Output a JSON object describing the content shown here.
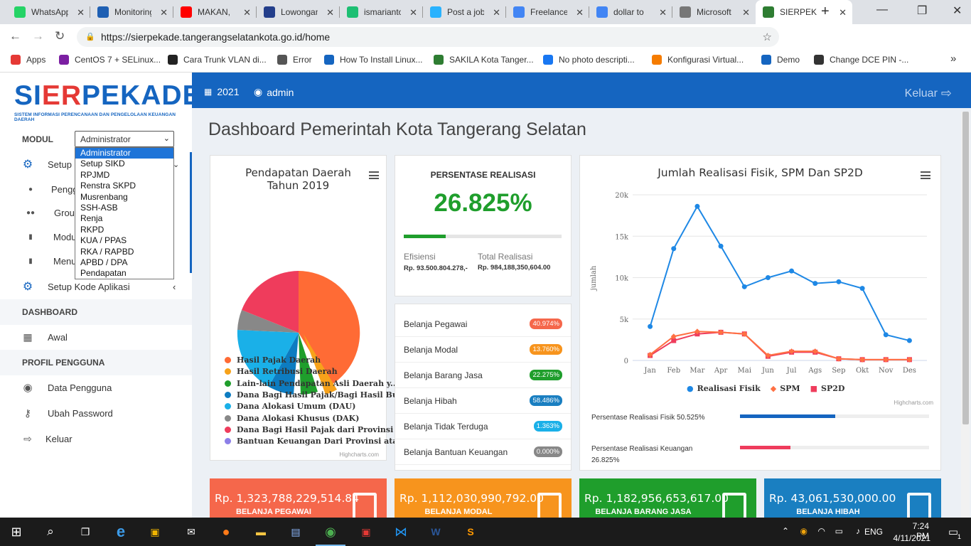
{
  "browser": {
    "tabs": [
      {
        "title": "WhatsApp",
        "icon": "whatsapp-icon",
        "color": "#25d366"
      },
      {
        "title": "Monitoring",
        "icon": "monitoring-icon",
        "color": "#1e5fb3"
      },
      {
        "title": "MAKAN,",
        "icon": "youtube-icon",
        "color": "#ff0000"
      },
      {
        "title": "Lowongan",
        "icon": "jobs-icon",
        "color": "#233e8b"
      },
      {
        "title": "ismarianto",
        "icon": "fiverr-icon",
        "color": "#1dbf73"
      },
      {
        "title": "Post a job",
        "icon": "freelancer-icon",
        "color": "#29b2fe"
      },
      {
        "title": "Freelance",
        "icon": "google-icon",
        "color": "#4285f4"
      },
      {
        "title": "dollar to",
        "icon": "google-icon",
        "color": "#4285f4"
      },
      {
        "title": "Microsoft",
        "icon": "globe-icon",
        "color": "#777777"
      },
      {
        "title": "SIERPEKA",
        "icon": "sierpekade-icon",
        "color": "#2e7d32"
      }
    ],
    "url": "https://sierpekade.tangerangselatankota.go.id/home",
    "bookmarks": [
      {
        "label": "Apps",
        "color": "#e53935"
      },
      {
        "label": "CentOS 7 + SELinux...",
        "color": "#7b1fa2"
      },
      {
        "label": "Cara Trunk VLAN di...",
        "color": "#222222"
      },
      {
        "label": "Error",
        "color": "#555555"
      },
      {
        "label": "How To Install Linux...",
        "color": "#1565c0"
      },
      {
        "label": "SAKILA Kota Tanger...",
        "color": "#2e7d32"
      },
      {
        "label": "No photo descripti...",
        "color": "#1877f2"
      },
      {
        "label": "Konfigurasi Virtual...",
        "color": "#f57c00"
      },
      {
        "label": "Demo",
        "color": "#1565c0"
      },
      {
        "label": "Change DCE PIN -...",
        "color": "#333333"
      }
    ],
    "more_bookmarks": "»"
  },
  "logo": {
    "part1": "SI",
    "part2": "ER",
    "part3": "PEKADE",
    "subtitle": "SISTEM INFORMASI PERENCANAAN DAN PENGELOLAAN KEUANGAN DAERAH"
  },
  "sidebar": {
    "modul_label": "MODUL",
    "modul_selected": "Administrator",
    "modul_options": [
      "Administrator",
      "Setup SIKD",
      "RPJMD",
      "Renstra SKPD",
      "Musrenbang",
      "SSH-ASB",
      "Renja",
      "RKPD",
      "KUA / PPAS",
      "RKA / RAPBD",
      "APBD / DPA",
      "Pendapatan"
    ],
    "setup_label": "Setup",
    "sub_items": [
      "Pengguna",
      "Group",
      "Modul",
      "Menu"
    ],
    "setup_kode": "Setup Kode Aplikasi",
    "dashboard_heading": "DASHBOARD",
    "awal": "Awal",
    "profil_heading": "PROFIL PENGGUNA",
    "data_pengguna": "Data Pengguna",
    "ubah_password": "Ubah Password",
    "keluar": "Keluar"
  },
  "topnav": {
    "year": "2021",
    "user": "admin",
    "logout": "Keluar"
  },
  "page_title": "Dashboard Pemerintah Kota Tangerang Selatan",
  "pie": {
    "title_line1": "Pendapatan Daerah",
    "title_line2": "Tahun 2019",
    "credit": "Highcharts.com",
    "legend": [
      {
        "name": "Hasil Pajak Daerah",
        "color": "#ff6b35"
      },
      {
        "name": "Hasil Retribusi Daerah",
        "color": "#f7a21a"
      },
      {
        "name": "Lain-lain Pendapatan Asli Daerah y...",
        "color": "#1f9e2c"
      },
      {
        "name": "Dana Bagi Hasil Pajak/Bagi Hasil Bu...",
        "color": "#0d7cc1"
      },
      {
        "name": "Dana Alokasi Umum (DAU)",
        "color": "#1ab0e8"
      },
      {
        "name": "Dana Alokasi Khusus (DAK)",
        "color": "#888888"
      },
      {
        "name": "Dana Bagi Hasil Pajak dari Provinsi ...",
        "color": "#ef3c5c"
      },
      {
        "name": "Bantuan Keuangan Dari Provinsi ata...",
        "color": "#8c7fe8"
      }
    ]
  },
  "realisasi": {
    "heading": "PERSENTASE REALISASI",
    "percent": "26.825%",
    "progress": 0.268,
    "efisiensi_label": "Efisiensi",
    "efisiensi_value": "Rp. 93.500.804.278,-",
    "total_label": "Total Realisasi",
    "total_value": "Rp. 984,188,350,604.00"
  },
  "belanja": [
    {
      "name": "Belanja Pegawai",
      "pct": "40.974%",
      "color": "#f5674b"
    },
    {
      "name": "Belanja Modal",
      "pct": "13.760%",
      "color": "#f7941d"
    },
    {
      "name": "Belanja Barang Jasa",
      "pct": "22.275%",
      "color": "#1f9e2c"
    },
    {
      "name": "Belanja Hibah",
      "pct": "58.486%",
      "color": "#1a7fc1"
    },
    {
      "name": "Belanja Tidak Terduga",
      "pct": "1.363%",
      "color": "#1ab0e8"
    },
    {
      "name": "Belanja Bantuan Keuangan",
      "pct": "0.000%",
      "color": "#888888"
    }
  ],
  "line": {
    "title": "Jumlah Realisasi Fisik, SPM Dan SP2D",
    "credit": "Highcharts.com",
    "fisik_label": "Persentase Realisasi Fisik 50.525%",
    "fisik_progress": 0.505,
    "keuangan_label": "Persentase Realisasi Keuangan 26.825%",
    "keuangan_progress": 0.268
  },
  "chart_data": {
    "type": "line",
    "title": "Jumlah Realisasi Fisik, SPM Dan SP2D",
    "ylabel": "Jumlah",
    "categories": [
      "Jan",
      "Feb",
      "Mar",
      "Apr",
      "Mai",
      "Jun",
      "Jul",
      "Ags",
      "Sep",
      "Okt",
      "Nov",
      "Des"
    ],
    "ylim": [
      0,
      20000
    ],
    "yticks": [
      "0",
      "5k",
      "10k",
      "15k",
      "20k"
    ],
    "series": [
      {
        "name": "Realisasi Fisik",
        "color": "#1e88e5",
        "values": [
          4100,
          13500,
          18600,
          13800,
          8900,
          10000,
          10800,
          9300,
          9500,
          8700,
          3100,
          2400
        ]
      },
      {
        "name": "SPM",
        "color": "#ff7043",
        "values": [
          700,
          2900,
          3500,
          3400,
          3200,
          600,
          1100,
          1100,
          200,
          100,
          100,
          100
        ]
      },
      {
        "name": "SP2D",
        "color": "#ef3c5c",
        "values": [
          600,
          2400,
          3200,
          3400,
          3200,
          500,
          1000,
          1000,
          200,
          100,
          100,
          100
        ]
      }
    ]
  },
  "stats": [
    {
      "amount": "Rp. 1,323,788,229,514.84",
      "label": "BELANJA PEGAWAI",
      "color": "#f5674b"
    },
    {
      "amount": "Rp. 1,112,030,990,792.00",
      "label": "BELANJA MODAL",
      "color": "#f7941d"
    },
    {
      "amount": "Rp. 1,182,956,653,617.00",
      "label": "BELANJA BARANG JASA",
      "color": "#1f9e2c"
    },
    {
      "amount": "Rp. 43,061,530,000.00",
      "label": "BELANJA HIBAH",
      "color": "#1a7fc1"
    }
  ],
  "taskbar": {
    "lang": "ENG",
    "time": "7:24 PM",
    "date": "4/11/2021",
    "notif": "1"
  }
}
